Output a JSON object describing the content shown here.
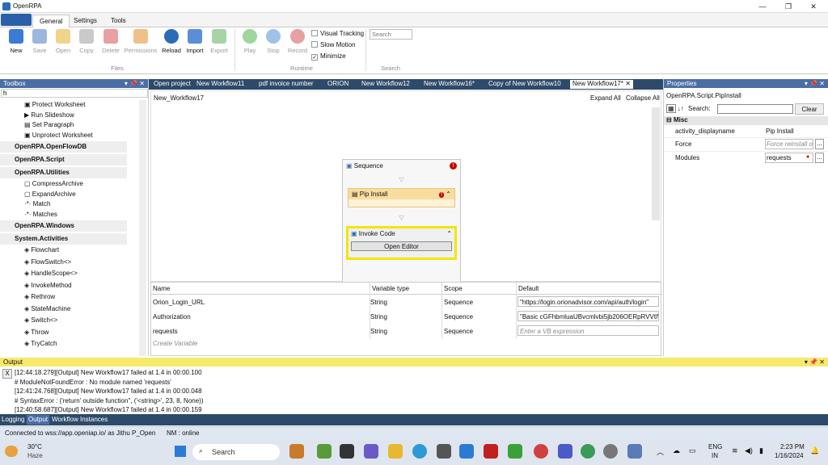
{
  "window": {
    "title": "OpenRPA"
  },
  "menu_tabs": [
    "General",
    "Settings",
    "Tools"
  ],
  "ribbon": {
    "buttons": [
      {
        "label": "New",
        "icon": "new-icon",
        "color": "#3a7bd5",
        "enabled": true
      },
      {
        "label": "Save",
        "icon": "save-icon",
        "color": "#9db6de",
        "enabled": false
      },
      {
        "label": "Open",
        "icon": "open-icon",
        "color": "#f0d48a",
        "enabled": false
      },
      {
        "label": "Copy",
        "icon": "copy-icon",
        "color": "#c9c9c9",
        "enabled": false
      },
      {
        "label": "Delete",
        "icon": "delete-icon",
        "color": "#e8a0a0",
        "enabled": false
      },
      {
        "label": "Permissions",
        "icon": "permissions-icon",
        "color": "#f0c08a",
        "enabled": false
      },
      {
        "label": "Reload",
        "icon": "reload-icon",
        "color": "#2b6cb8",
        "enabled": true
      },
      {
        "label": "Import",
        "icon": "import-icon",
        "color": "#5a8fd8",
        "enabled": true
      },
      {
        "label": "Export",
        "icon": "export-icon",
        "color": "#a6d4a6",
        "enabled": false
      }
    ],
    "runtime_buttons": [
      {
        "label": "Play",
        "icon": "play-icon",
        "color": "#9fd59f"
      },
      {
        "label": "Stop",
        "icon": "stop-icon",
        "color": "#9fc2e8"
      },
      {
        "label": "Record",
        "icon": "record-icon",
        "color": "#e8a0a0"
      }
    ],
    "options": {
      "visual_tracking": "Visual Tracking",
      "slow_motion": "Slow Motion",
      "minimize": "Minimize"
    },
    "search_placeholder": "Search",
    "groups": {
      "files": "Files",
      "runtime": "Runtime",
      "search": "Search"
    }
  },
  "toolbox": {
    "title": "Toolbox",
    "search_value": "h",
    "items_top": [
      "Protect Worksheet",
      "Run Slideshow",
      "Set Paragraph",
      "Unprotect Worksheet"
    ],
    "cat1": "OpenRPA.OpenFlowDB",
    "cat2": "OpenRPA.Script",
    "cat3": "OpenRPA.Utilities",
    "utilities": [
      "CompressArchive",
      "ExpandArchive",
      "Match",
      "Matches"
    ],
    "cat4": "OpenRPA.Windows",
    "cat5": "System.Activities",
    "system": [
      "Flowchart",
      "FlowSwitch<>",
      "HandleScope<>",
      "InvokeMethod",
      "Rethrow",
      "StateMachine",
      "Switch<>",
      "Throw",
      "TryCatch"
    ]
  },
  "doc_tabs": [
    "Open project",
    "New Workflow11",
    "pdf invoice number",
    "ORION",
    "New Workflow12",
    "New Workflow16*",
    "Copy of New Workflow10",
    "New Workflow17*"
  ],
  "designer": {
    "breadcrumb": "New_Workflow17",
    "expand_all": "Expand All",
    "collapse_all": "Collapse All",
    "sequence_label": "Sequence",
    "pip_label": "Pip Install",
    "invoke_label": "Invoke Code",
    "open_editor": "Open Editor"
  },
  "variables": {
    "headers": [
      "Name",
      "Variable type",
      "Scope",
      "Default"
    ],
    "rows": [
      [
        "Orion_Login_URL",
        "String",
        "Sequence",
        "\"https://login.orionadvisor.com/api/auth/login\""
      ],
      [
        "Authorization",
        "String",
        "Sequence",
        "\"Basic cGFhbmluaUBvcmlvbi5jb206OERpRVVtlW"
      ],
      [
        "requests",
        "String",
        "Sequence",
        ""
      ]
    ],
    "default_placeholder": "Enter a VB expression",
    "create_variable": "Create Variable"
  },
  "properties": {
    "title": "Properties",
    "subject": "OpenRPA.Script.PipInstall",
    "search_label": "Search:",
    "clear_label": "Clear",
    "category": "Misc",
    "rows": [
      {
        "name": "activity_displayname",
        "value": "Pip Install"
      },
      {
        "name": "Force",
        "value": "Force reinstall o"
      },
      {
        "name": "Modules",
        "value": "requests"
      }
    ],
    "more": "..."
  },
  "output": {
    "title": "Output",
    "clear": "X",
    "lines": [
      "[12:44:18.279][Output] New Workflow17 failed at 1.4 in 00:00.100",
      "# ModuleNotFoundError : No module named 'requests'",
      "[12:41:24.768][Output] New Workflow17 failed at 1.4 in 00:00.048",
      "# SyntaxError : ('return' outside function\", ('<string>', 23, 8, None))",
      "[12:40:58.687][Output] New Workflow17 failed at 1.4 in 00:00.159"
    ]
  },
  "bottom_tabs": [
    "Logging",
    "Output",
    "Workflow Instances"
  ],
  "status": {
    "connection": "Connected to wss://app.openiap.io/ as Jithu P_Open",
    "nm": "NM : online"
  },
  "taskbar": {
    "temp": "30°C",
    "weather": "Haze",
    "search": "Search",
    "lang1": "ENG",
    "lang2": "IN",
    "time": "2:23 PM",
    "date": "1/16/2024"
  }
}
